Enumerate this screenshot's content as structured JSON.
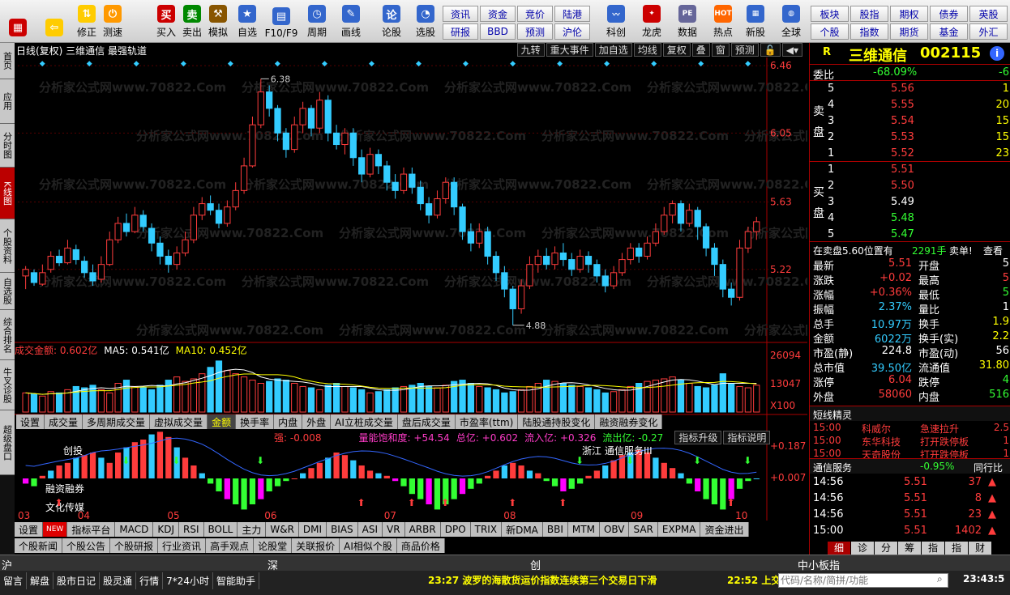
{
  "toolbar": {
    "buttons": [
      {
        "label": "",
        "icon": "app-grid-icon"
      },
      {
        "label": "",
        "icon": "back-arrow-icon"
      },
      {
        "label": "修正",
        "icon": "arrow-updown-icon"
      },
      {
        "label": "测速",
        "icon": "clock-icon"
      },
      {
        "label": "买入",
        "icon": "buy-icon"
      },
      {
        "label": "卖出",
        "icon": "sell-icon"
      },
      {
        "label": "模拟",
        "icon": "hammer-icon"
      },
      {
        "label": "自选",
        "icon": "star-icon"
      },
      {
        "label": "F10/F9",
        "icon": "window-icon"
      },
      {
        "label": "周期",
        "icon": "cycle-icon"
      },
      {
        "label": "画线",
        "icon": "pencil-icon"
      },
      {
        "label": "论股",
        "icon": "discuss-icon"
      },
      {
        "label": "选股",
        "icon": "select-icon"
      }
    ],
    "small_buttons_row1": [
      "资讯",
      "资金",
      "竞价",
      "陆港"
    ],
    "small_buttons_row2": [
      "研报",
      "BBD",
      "预测",
      "沪伦"
    ],
    "mid_buttons": [
      {
        "label": "科创",
        "icon": "chart-icon"
      },
      {
        "label": "龙虎",
        "icon": "dragon-icon"
      },
      {
        "label": "数据",
        "icon": "pe-icon"
      },
      {
        "label": "热点",
        "icon": "hot-icon"
      },
      {
        "label": "新股",
        "icon": "newstock-icon"
      },
      {
        "label": "全球",
        "icon": "globe-icon"
      }
    ],
    "right_row1": [
      "板块",
      "股指",
      "期权",
      "债券",
      "英股"
    ],
    "right_row2": [
      "个股",
      "指数",
      "期货",
      "基金",
      "外汇"
    ]
  },
  "leftnav": [
    "首页",
    "应用",
    "分时图",
    "K线图",
    "个股资料",
    "自选股",
    "综合排名",
    "牛叉诊股",
    "超级盘口"
  ],
  "chart": {
    "title": "日线(复权) 三维通信 最强轨道",
    "topbar": [
      "九转",
      "重大事件",
      "加自选",
      "均线",
      "复权",
      "叠",
      "窗",
      "预测"
    ],
    "price_high_label": "6.38",
    "price_low_label": "4.88",
    "price_ticks": [
      "6.46",
      "6.05",
      "5.63",
      "5.22"
    ],
    "watermark": "分析家公式网www.70822.Com",
    "vol_title": "成交金额: 0.602亿",
    "vol_ma5": "MA5: 0.541亿",
    "vol_ma10": "MA10: 0.452亿",
    "vol_ticks": [
      "26094",
      "13047",
      "X100"
    ],
    "ind_tabs": [
      "设置",
      "成交量",
      "多周期成交量",
      "虚拟成交量",
      "金额",
      "换手率",
      "内盘",
      "外盘",
      "AI立桩成交量",
      "盘后成交量",
      "市盈率(ttm)",
      "陆股通持股变化",
      "融资融券变化"
    ],
    "ind_line": "强: -0.008",
    "ind_items": [
      "量能饱和度: +54.54",
      "总亿: +0.602",
      "流入亿: +0.326",
      "流出亿: -0.27"
    ],
    "ind_buttons": [
      "指标升级",
      "指标说明"
    ],
    "ind_ticks": [
      "+0.187",
      "+0.007"
    ],
    "ind_labels": [
      "创投",
      "融资融券",
      "文化传媒",
      "浙江",
      "通信服务III"
    ],
    "months": [
      "03",
      "04",
      "05",
      "06",
      "07",
      "08",
      "09",
      "10"
    ],
    "bottom_tabs1": [
      "设置",
      "NEW",
      "指标平台",
      "MACD",
      "KDJ",
      "RSI",
      "BOLL",
      "主力",
      "W&R",
      "DMI",
      "BIAS",
      "ASI",
      "VR",
      "ARBR",
      "DPO",
      "TRIX",
      "新DMA",
      "BBI",
      "MTM",
      "OBV",
      "SAR",
      "EXPMA",
      "资金进出"
    ],
    "bottom_tabs2": [
      "个股新闻",
      "个股公告",
      "个股研报",
      "行业资讯",
      "高手观点",
      "论股堂",
      "关联报价",
      "AI相似个股",
      "商品价格"
    ]
  },
  "quote": {
    "tag": "R",
    "name": "三维通信",
    "code": "002115",
    "weibi_label": "委比",
    "weibi": "-68.09%",
    "weibi_right": "-6",
    "sell_label": "卖盘",
    "buy_label": "买盘",
    "asks": [
      {
        "lv": "5",
        "price": "5.56",
        "vol": "1"
      },
      {
        "lv": "4",
        "price": "5.55",
        "vol": "20"
      },
      {
        "lv": "3",
        "price": "5.54",
        "vol": "15"
      },
      {
        "lv": "2",
        "price": "5.53",
        "vol": "15"
      },
      {
        "lv": "1",
        "price": "5.52",
        "vol": "23"
      }
    ],
    "bids": [
      {
        "lv": "1",
        "price": "5.51",
        "vol": ""
      },
      {
        "lv": "2",
        "price": "5.50",
        "vol": ""
      },
      {
        "lv": "3",
        "price": "5.49",
        "vol": ""
      },
      {
        "lv": "4",
        "price": "5.48",
        "vol": ""
      },
      {
        "lv": "5",
        "price": "5.47",
        "vol": ""
      }
    ],
    "notice": "在卖盘5.60位置有",
    "notice_vol": "2291手",
    "notice_action": "卖单!",
    "notice_link": "查看",
    "stats": [
      [
        "最新",
        "5.51",
        "开盘",
        "5"
      ],
      [
        "涨跌",
        "+0.02",
        "最高",
        "5"
      ],
      [
        "涨幅",
        "+0.36%",
        "最低",
        "5"
      ],
      [
        "振幅",
        "2.37%",
        "量比",
        "1"
      ],
      [
        "总手",
        "10.97万",
        "换手",
        "1.9"
      ],
      [
        "金额",
        "6022万",
        "换手(实)",
        "2.2"
      ],
      [
        "市盈(静)",
        "224.8",
        "市盈(动)",
        "56"
      ],
      [
        "总市值",
        "39.50亿",
        "流通值",
        "31.80"
      ],
      [
        "涨停",
        "6.04",
        "跌停",
        "4"
      ],
      [
        "外盘",
        "58060",
        "内盘",
        "516"
      ]
    ],
    "elf_title": "短线精灵",
    "elf": [
      [
        "15:00",
        "科威尔",
        "急速拉升",
        "2.5"
      ],
      [
        "15:00",
        "东华科技",
        "打开跌停板",
        "1"
      ],
      [
        "15:00",
        "天奇股份",
        "打开跌停板",
        "1"
      ]
    ],
    "sector": "通信服务",
    "sector_chg": "-0.95%",
    "sector_link": "同行比",
    "ticks": [
      [
        "14:56",
        "5.51",
        "37"
      ],
      [
        "14:56",
        "5.51",
        "8"
      ],
      [
        "14:56",
        "5.51",
        "23"
      ],
      [
        "15:00",
        "5.51",
        "1402"
      ]
    ],
    "rtabs": [
      "细",
      "诊",
      "分",
      "筹",
      "指",
      "指",
      "财"
    ]
  },
  "status": {
    "row1": [
      "沪",
      "深",
      "创",
      "中小板指"
    ],
    "row2": [
      "留言",
      "解盘",
      "股市日记",
      "股灵通",
      "行情",
      "7*24小时",
      "智能助手"
    ],
    "news1": "23:27 波罗的海散货运价指数连续第三个交易日下滑",
    "news2": "22:52 上交",
    "search_placeholder": "代码/名称/简拼/功能",
    "clock": "23:43:5"
  },
  "colors": {
    "up": "#ff3c3c",
    "down": "#3cf",
    "accent": "#b00"
  },
  "chart_data": {
    "type": "candlestick",
    "ylim": [
      4.8,
      6.5
    ],
    "price_ticks": [
      6.46,
      6.05,
      5.63,
      5.22
    ],
    "candles": [
      [
        5.18,
        5.22,
        5.24,
        5.1
      ],
      [
        5.2,
        5.14,
        5.22,
        5.12
      ],
      [
        5.13,
        5.2,
        5.25,
        5.12
      ],
      [
        5.22,
        5.3,
        5.33,
        5.2
      ],
      [
        5.3,
        5.26,
        5.34,
        5.24
      ],
      [
        5.26,
        5.35,
        5.4,
        5.25
      ],
      [
        5.34,
        5.28,
        5.37,
        5.25
      ],
      [
        5.27,
        5.2,
        5.3,
        5.17
      ],
      [
        5.2,
        5.15,
        5.25,
        5.12
      ],
      [
        5.16,
        5.25,
        5.3,
        5.14
      ],
      [
        5.25,
        5.4,
        5.45,
        5.24
      ],
      [
        5.4,
        5.5,
        5.54,
        5.38
      ],
      [
        5.5,
        5.45,
        5.56,
        5.42
      ],
      [
        5.45,
        5.55,
        5.6,
        5.44
      ],
      [
        5.55,
        5.48,
        5.58,
        5.45
      ],
      [
        5.47,
        5.38,
        5.5,
        5.33
      ],
      [
        5.38,
        5.3,
        5.42,
        5.25
      ],
      [
        5.3,
        5.25,
        5.34,
        5.2
      ],
      [
        5.25,
        5.32,
        5.36,
        5.22
      ],
      [
        5.32,
        5.4,
        5.45,
        5.3
      ],
      [
        5.4,
        5.55,
        5.6,
        5.38
      ],
      [
        5.55,
        5.62,
        5.66,
        5.52
      ],
      [
        5.62,
        5.58,
        5.67,
        5.55
      ],
      [
        5.58,
        5.5,
        5.62,
        5.47
      ],
      [
        5.5,
        5.6,
        5.64,
        5.48
      ],
      [
        5.6,
        5.7,
        5.75,
        5.58
      ],
      [
        5.7,
        5.85,
        5.9,
        5.68
      ],
      [
        5.85,
        6.1,
        6.15,
        5.84
      ],
      [
        6.1,
        6.3,
        6.38,
        6.08
      ],
      [
        6.3,
        6.2,
        6.34,
        6.15
      ],
      [
        6.2,
        6.05,
        6.22,
        6.0
      ],
      [
        6.05,
        5.95,
        6.08,
        5.9
      ],
      [
        5.95,
        6.1,
        6.15,
        5.93
      ],
      [
        6.1,
        6.2,
        6.24,
        6.05
      ],
      [
        6.2,
        6.08,
        6.22,
        6.03
      ],
      [
        6.08,
        6.25,
        6.3,
        6.05
      ],
      [
        6.25,
        6.05,
        6.28,
        6.0
      ],
      [
        6.05,
        5.98,
        6.1,
        5.95
      ],
      [
        5.98,
        6.05,
        6.08,
        5.92
      ],
      [
        6.05,
        5.9,
        6.08,
        5.85
      ],
      [
        5.9,
        5.8,
        5.95,
        5.75
      ],
      [
        5.8,
        5.92,
        5.96,
        5.78
      ],
      [
        5.92,
        5.85,
        5.95,
        5.8
      ],
      [
        5.85,
        5.75,
        5.88,
        5.7
      ],
      [
        5.75,
        5.7,
        5.8,
        5.65
      ],
      [
        5.7,
        5.8,
        5.84,
        5.68
      ],
      [
        5.8,
        5.72,
        5.84,
        5.68
      ],
      [
        5.72,
        5.62,
        5.76,
        5.58
      ],
      [
        5.62,
        5.55,
        5.66,
        5.5
      ],
      [
        5.55,
        5.65,
        5.7,
        5.53
      ],
      [
        5.65,
        5.75,
        5.78,
        5.62
      ],
      [
        5.75,
        5.6,
        5.78,
        5.55
      ],
      [
        5.6,
        5.45,
        5.62,
        5.4
      ],
      [
        5.45,
        5.38,
        5.5,
        5.33
      ],
      [
        5.38,
        5.45,
        5.5,
        5.35
      ],
      [
        5.45,
        5.3,
        5.48,
        5.25
      ],
      [
        5.3,
        5.2,
        5.33,
        5.15
      ],
      [
        5.2,
        5.1,
        5.24,
        5.05
      ],
      [
        5.1,
        4.98,
        5.12,
        4.88
      ],
      [
        4.98,
        5.12,
        5.16,
        4.95
      ],
      [
        5.12,
        5.25,
        5.3,
        5.1
      ],
      [
        5.25,
        5.3,
        5.34,
        5.2
      ],
      [
        5.3,
        5.25,
        5.35,
        5.22
      ],
      [
        5.25,
        5.32,
        5.36,
        5.22
      ],
      [
        5.32,
        5.28,
        5.38,
        5.24
      ],
      [
        5.28,
        5.22,
        5.32,
        5.18
      ],
      [
        5.22,
        5.3,
        5.34,
        5.2
      ],
      [
        5.3,
        5.25,
        5.33,
        5.2
      ],
      [
        5.25,
        5.18,
        5.28,
        5.14
      ],
      [
        5.18,
        5.12,
        5.22,
        5.08
      ],
      [
        5.12,
        5.2,
        5.24,
        5.1
      ],
      [
        5.2,
        5.28,
        5.32,
        5.18
      ],
      [
        5.28,
        5.35,
        5.38,
        5.25
      ],
      [
        5.35,
        5.3,
        5.38,
        5.26
      ],
      [
        5.3,
        5.38,
        5.42,
        5.28
      ],
      [
        5.38,
        5.45,
        5.5,
        5.36
      ],
      [
        5.45,
        5.55,
        5.6,
        5.43
      ],
      [
        5.55,
        5.62,
        5.64,
        5.5
      ],
      [
        5.62,
        5.5,
        5.64,
        5.45
      ],
      [
        5.5,
        5.58,
        5.62,
        5.48
      ],
      [
        5.58,
        5.48,
        5.6,
        5.4
      ],
      [
        5.48,
        5.35,
        5.5,
        5.3
      ],
      [
        5.35,
        5.25,
        5.38,
        5.18
      ],
      [
        5.25,
        5.1,
        5.28,
        5.05
      ],
      [
        5.1,
        5.05,
        5.14,
        5.0
      ],
      [
        5.05,
        5.35,
        5.4,
        5.03
      ],
      [
        5.35,
        5.45,
        5.48,
        5.32
      ],
      [
        5.45,
        5.51,
        5.54,
        5.4
      ]
    ],
    "volume": [
      30,
      28,
      25,
      32,
      30,
      35,
      40,
      38,
      42,
      35,
      30,
      45,
      50,
      40,
      38,
      35,
      42,
      50,
      55,
      48,
      52,
      60,
      70,
      80,
      65,
      60,
      55,
      50,
      45,
      48,
      52,
      50,
      45,
      40,
      38,
      35,
      42,
      45,
      40,
      38,
      35,
      30,
      32,
      35,
      38,
      40,
      42,
      45,
      40,
      38,
      42,
      48,
      50,
      45,
      40,
      38,
      35,
      30,
      32,
      35,
      40,
      45,
      50,
      48,
      45,
      42,
      40,
      38,
      35,
      30,
      32,
      35,
      40,
      45,
      48,
      50,
      52,
      55,
      50,
      45,
      40,
      38,
      42,
      60,
      45,
      40,
      38,
      42
    ],
    "indicator": [
      -0.02,
      -0.03,
      0.01,
      0.03,
      0.05,
      0.06,
      0.08,
      0.09,
      0.1,
      0.08,
      0.06,
      0.1,
      0.12,
      0.14,
      0.15,
      0.17,
      0.18,
      0.16,
      0.12,
      0.08,
      0.05,
      0.02,
      -0.02,
      -0.05,
      -0.08,
      -0.1,
      -0.12,
      -0.1,
      -0.08,
      -0.05,
      -0.03,
      -0.01,
      0.0,
      0.02,
      0.04,
      0.06,
      0.08,
      0.1,
      0.09,
      0.07,
      0.05,
      0.03,
      0.02,
      0.01,
      -0.01,
      -0.03,
      -0.06,
      -0.08,
      -0.1,
      -0.12,
      -0.1,
      -0.08,
      -0.06,
      -0.04,
      -0.02,
      0.01,
      0.03,
      0.05,
      0.06,
      0.05,
      0.03,
      0.02,
      -0.01,
      -0.03,
      -0.05,
      -0.04,
      -0.02,
      0.01,
      0.03,
      0.05,
      0.07,
      0.09,
      0.1,
      0.11,
      0.1,
      0.08,
      0.06,
      0.04,
      0.02,
      -0.02,
      -0.05,
      -0.08,
      -0.1,
      -0.12,
      -0.08,
      -0.04,
      -0.01,
      0.0
    ]
  }
}
